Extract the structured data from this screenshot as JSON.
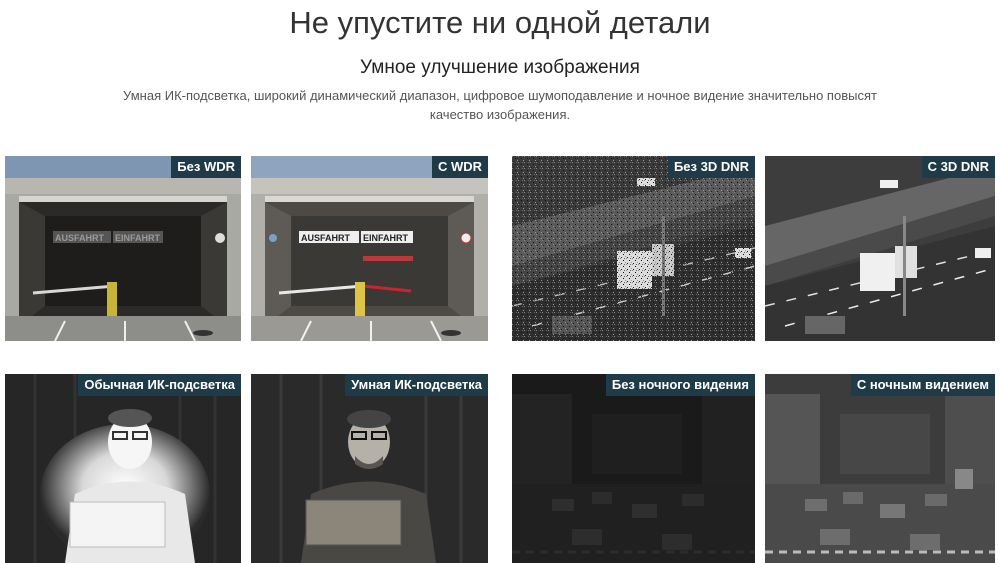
{
  "header": {
    "title": "Не упустите ни одной детали",
    "subtitle": "Умное улучшение изображения",
    "description": "Умная ИК-подсветка, широкий динамический диапазон, цифровое шумоподавление и ночное видение значительно повысят качество изображения."
  },
  "tiles": [
    {
      "label": "Без WDR",
      "sign_left": "AUSFAHRT",
      "sign_right": "EINFAHRT"
    },
    {
      "label": "С WDR",
      "sign_left": "AUSFAHRT",
      "sign_right": "EINFAHRT"
    },
    {
      "label": "Без 3D DNR"
    },
    {
      "label": "С 3D DNR"
    },
    {
      "label": "Обычная ИК-подсветка"
    },
    {
      "label": "Умная ИК-подсветка"
    },
    {
      "label": "Без ночного видения"
    },
    {
      "label": "С ночным видением"
    }
  ],
  "colors": {
    "badge_bg": "#1f3b47",
    "badge_text": "#ffffff",
    "title_text": "#333333"
  }
}
